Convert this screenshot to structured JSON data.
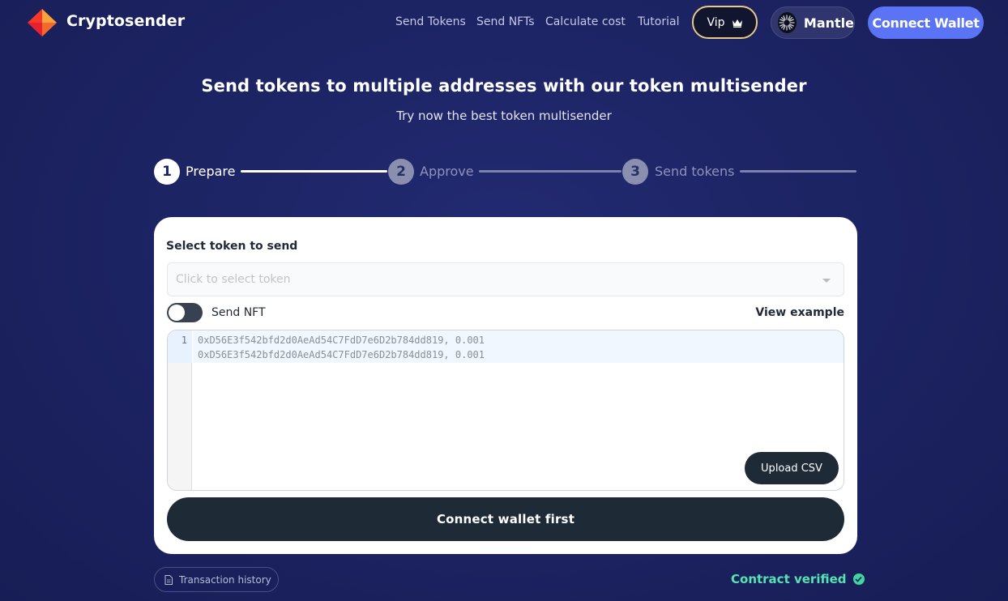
{
  "header": {
    "brand": "Cryptosender",
    "nav": [
      {
        "label": "Send Tokens"
      },
      {
        "label": "Send NFTs"
      },
      {
        "label": "Calculate cost"
      },
      {
        "label": "Tutorial"
      }
    ],
    "vip_label": "Vip",
    "network_label": "Mantle",
    "connect_label": "Connect Wallet"
  },
  "hero": {
    "title": "Send tokens to multiple addresses with our token multisender",
    "subtitle": "Try now the best token multisender"
  },
  "stepper": {
    "steps": [
      {
        "number": "1",
        "label": "Prepare",
        "active": true
      },
      {
        "number": "2",
        "label": "Approve",
        "active": false
      },
      {
        "number": "3",
        "label": "Send tokens",
        "active": false
      }
    ]
  },
  "form": {
    "select_label": "Select token to send",
    "token_placeholder": "Click to select token",
    "send_nft_label": "Send NFT",
    "send_nft_enabled": false,
    "view_example_label": "View example",
    "editor": {
      "line_numbers": [
        "1"
      ],
      "lines": [
        "0xD56E3f542bfd2d0AeAd54C7FdD7e6D2b784dd819, 0.001",
        "0xD56E3f542bfd2d0AeAd54C7FdD7e6D2b784dd819, 0.001"
      ]
    },
    "upload_label": "Upload CSV",
    "submit_label": "Connect wallet first"
  },
  "footer": {
    "history_label": "Transaction history",
    "verified_label": "Contract verified"
  },
  "colors": {
    "background": "#1d2464",
    "accent": "#5b74f5",
    "vip_border": "#e9c98a",
    "verified": "#57e3b1",
    "button_dark": "#1f2a37"
  }
}
